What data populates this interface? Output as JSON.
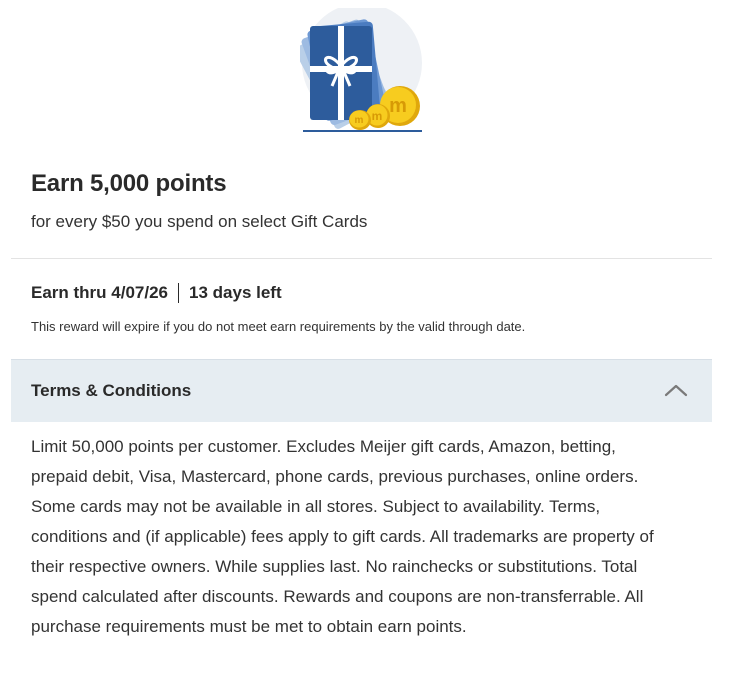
{
  "offer": {
    "title": "Earn 5,000 points",
    "subtitle": "for every $50 you spend on select Gift Cards",
    "hero_icon": "gift-card-coins-icon"
  },
  "earn": {
    "date_text": "Earn thru 4/07/26",
    "days_left": "13 days left",
    "expire_note": "This reward will expire if you do not meet earn requirements by the valid through date."
  },
  "terms": {
    "heading": "Terms & Conditions",
    "expanded_icon": "chevron-up-icon",
    "body": "Limit 50,000 points per customer. Excludes Meijer gift cards, Amazon, betting, prepaid debit, Visa, Mastercard, phone cards, previous purchases, online orders. Some cards may not be available in all stores. Subject to availability. Terms, conditions and (if applicable) fees apply to gift cards. All trademarks are property of their respective owners. While supplies last. No rainchecks or substitutions. Total spend calculated after discounts. Rewards and coupons are non-transferrable. All purchase requirements must be met to obtain earn points."
  },
  "colors": {
    "card_blue": "#2d5c9c",
    "coin_gold": "#f2c319",
    "header_bg": "#e6edf2"
  }
}
